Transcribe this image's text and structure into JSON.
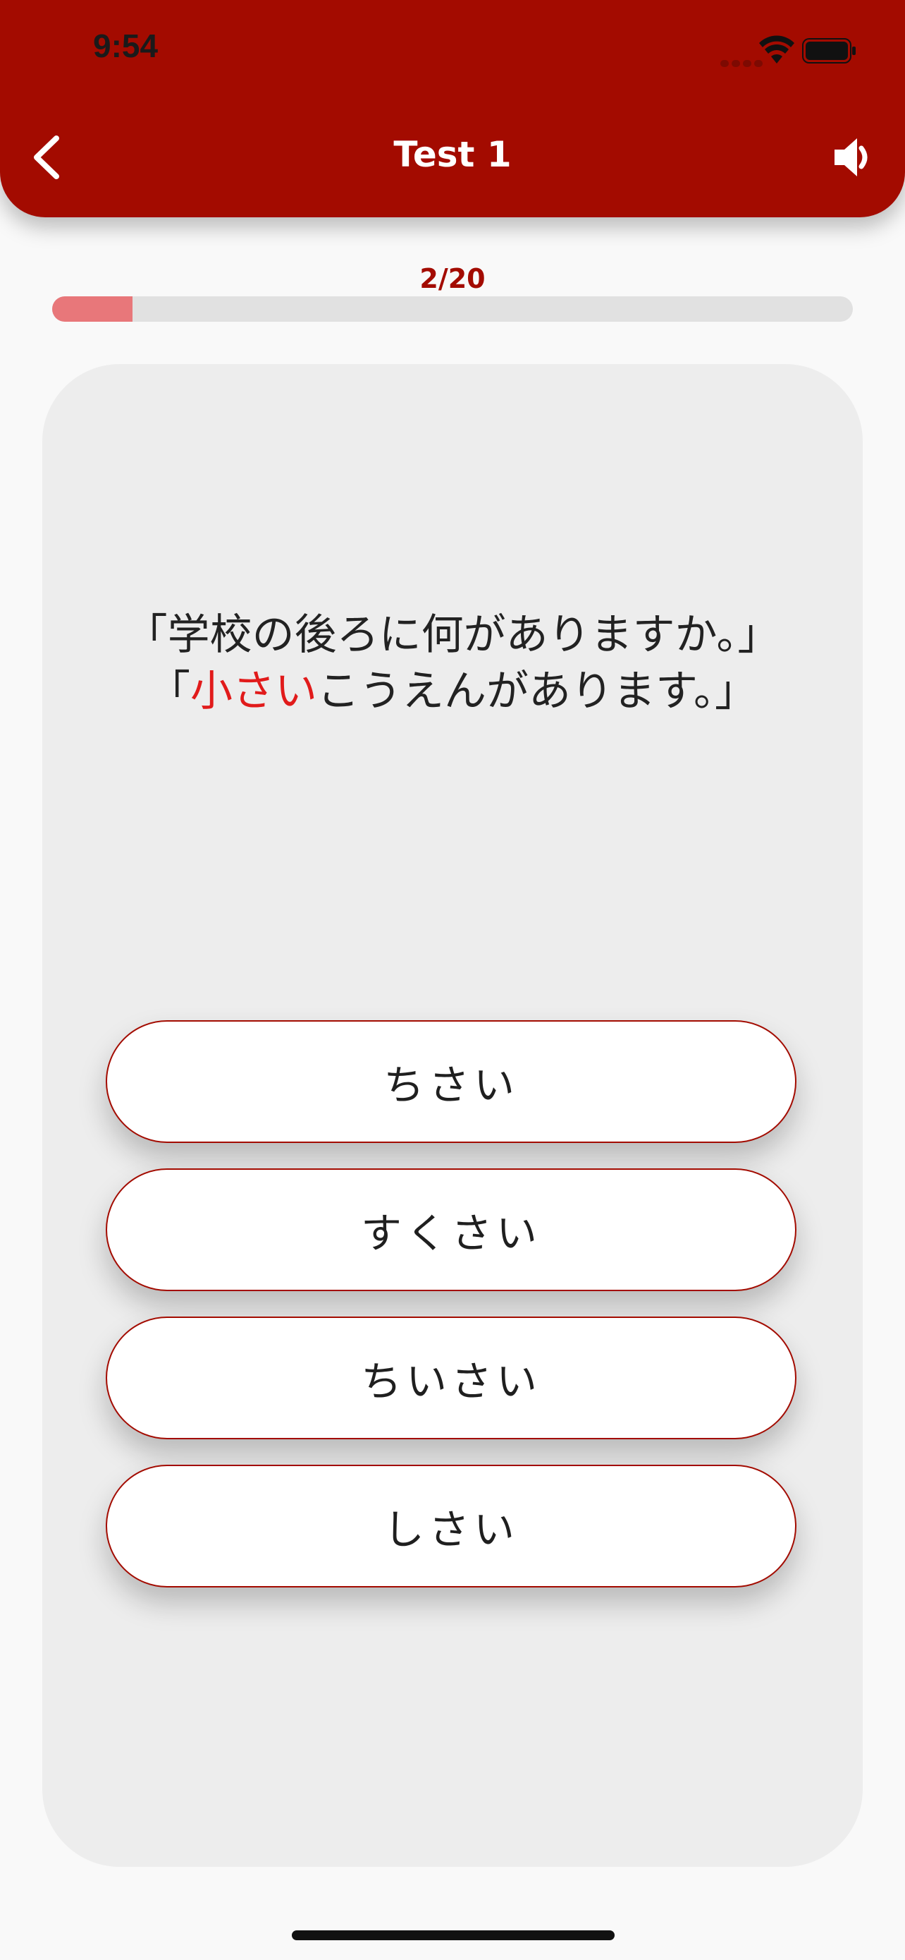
{
  "status_bar": {
    "time": "9:54"
  },
  "header": {
    "title": "Test 1"
  },
  "progress": {
    "label": "2/20",
    "fraction": 0.1
  },
  "question": {
    "line1": "「学校の後ろに何がありますか。」",
    "line2_prefix": "「",
    "line2_highlight": "小さい",
    "line2_suffix": "こうえんがあります。」"
  },
  "answers": [
    {
      "label": "ちさい"
    },
    {
      "label": "すくさい"
    },
    {
      "label": "ちいさい"
    },
    {
      "label": "しさい"
    }
  ],
  "colors": {
    "brand": "#a30b00",
    "highlight": "#e11b1b",
    "progress_fill": "#e8777a"
  },
  "icons": {
    "back": "chevron-left-icon",
    "sound": "speaker-icon",
    "wifi": "wifi-icon",
    "battery": "battery-icon"
  }
}
